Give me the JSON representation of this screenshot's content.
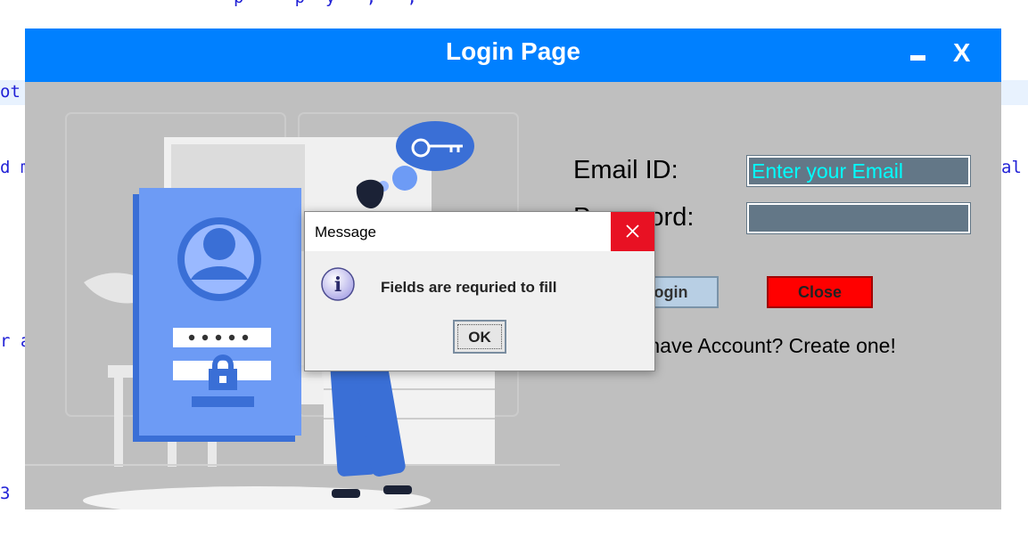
{
  "ide": {
    "line1": "p     p  y   ,   ;",
    "line2": "ot",
    "line3": "d m",
    "line4": "al",
    "line5": "r a",
    "line6": "3"
  },
  "window": {
    "title": "Login Page",
    "minimize_icon": "minimize-icon",
    "close_label": "X"
  },
  "form": {
    "email_label": "Email ID:",
    "email_placeholder": "Enter your Email",
    "password_label": "Password:",
    "password_value": "",
    "login_label": "Login",
    "close_label": "Close",
    "signup_text": "Don't have Account? Create one!"
  },
  "dialog": {
    "title": "Message",
    "icon": "info-icon",
    "message": "Fields are requried to fill",
    "ok_label": "OK"
  },
  "colors": {
    "titlebar": "#0080ff",
    "window_bg": "#bfbfbf",
    "field_bg": "#637787",
    "field_text": "#00ffff",
    "close_button": "#ff0000",
    "login_button": "#b8cfe4",
    "dialog_close": "#e81123"
  }
}
